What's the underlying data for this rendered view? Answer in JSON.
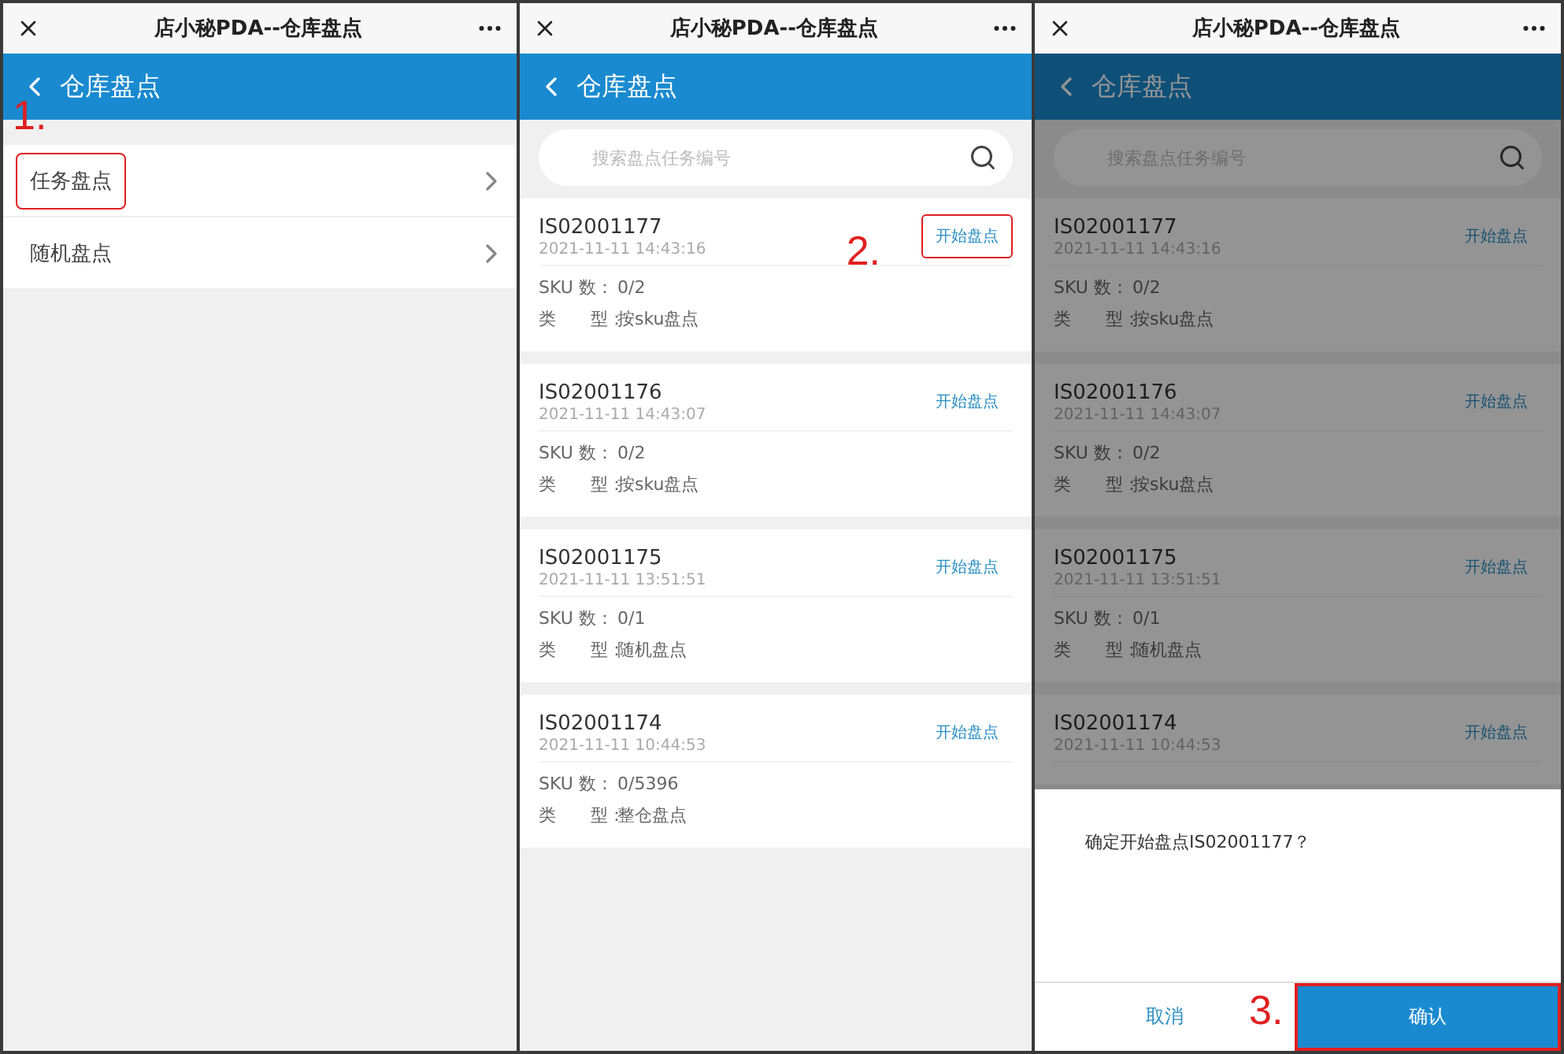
{
  "panels": [
    {
      "kind": "menu",
      "window_title": "店小秘PDA--仓库盘点",
      "header": "仓库盘点",
      "dimmed": false,
      "step": "1.",
      "items": [
        {
          "label": "任务盘点",
          "highlighted": true
        },
        {
          "label": "随机盘点",
          "highlighted": false
        }
      ]
    },
    {
      "kind": "tasks",
      "window_title": "店小秘PDA--仓库盘点",
      "header": "仓库盘点",
      "dimmed": false,
      "step": "2.",
      "search": {
        "placeholder": "搜索盘点任务编号"
      },
      "cards": [
        {
          "code": "IS02001177",
          "date": "2021-11-11 14:43:16",
          "sku_label": "SKU 数：",
          "sku": "0/2",
          "type_label": "类　　型：",
          "type": "按sku盘点",
          "action": "开始盘点",
          "highlighted": true
        },
        {
          "code": "IS02001176",
          "date": "2021-11-11 14:43:07",
          "sku_label": "SKU 数：",
          "sku": "0/2",
          "type_label": "类　　型：",
          "type": "按sku盘点",
          "action": "开始盘点",
          "highlighted": false
        },
        {
          "code": "IS02001175",
          "date": "2021-11-11 13:51:51",
          "sku_label": "SKU 数：",
          "sku": "0/1",
          "type_label": "类　　型：",
          "type": "随机盘点",
          "action": "开始盘点",
          "highlighted": false
        },
        {
          "code": "IS02001174",
          "date": "2021-11-11 10:44:53",
          "sku_label": "SKU 数：",
          "sku": "0/5396",
          "type_label": "类　　型：",
          "type": "整仓盘点",
          "action": "开始盘点",
          "highlighted": false
        }
      ]
    },
    {
      "kind": "tasks",
      "window_title": "店小秘PDA--仓库盘点",
      "header": "仓库盘点",
      "dimmed": true,
      "step": "3.",
      "search": {
        "placeholder": "搜索盘点任务编号"
      },
      "cards": [
        {
          "code": "IS02001177",
          "date": "2021-11-11 14:43:16",
          "sku_label": "SKU 数：",
          "sku": "0/2",
          "type_label": "类　　型：",
          "type": "按sku盘点",
          "action": "开始盘点",
          "highlighted": false
        },
        {
          "code": "IS02001176",
          "date": "2021-11-11 14:43:07",
          "sku_label": "SKU 数：",
          "sku": "0/2",
          "type_label": "类　　型：",
          "type": "按sku盘点",
          "action": "开始盘点",
          "highlighted": false
        },
        {
          "code": "IS02001175",
          "date": "2021-11-11 13:51:51",
          "sku_label": "SKU 数：",
          "sku": "0/1",
          "type_label": "类　　型：",
          "type": "随机盘点",
          "action": "开始盘点",
          "highlighted": false
        },
        {
          "code": "IS02001174",
          "date": "2021-11-11 10:44:53",
          "action": "开始盘点",
          "highlighted": false
        }
      ],
      "dialog": {
        "message": "确定开始盘点IS02001177？",
        "cancel": "取消",
        "confirm": "确认",
        "confirm_highlighted": true
      }
    }
  ]
}
